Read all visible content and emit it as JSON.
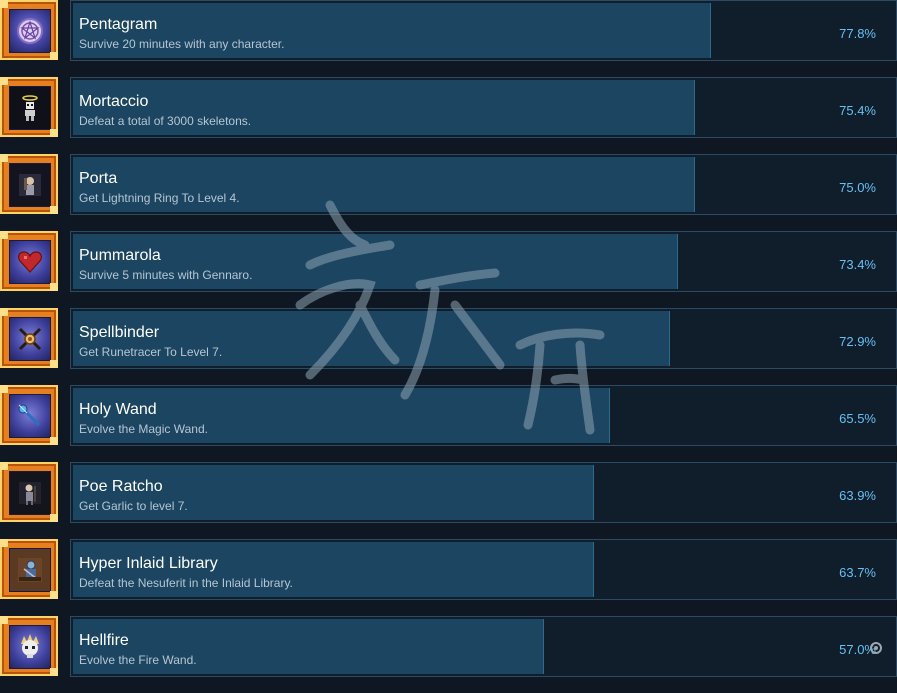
{
  "achievements": [
    {
      "title": "Pentagram",
      "desc": "Survive 20 minutes with any character.",
      "percent": "77.8%",
      "value": 77.8,
      "icon": "pentagram-icon"
    },
    {
      "title": "Mortaccio",
      "desc": "Defeat a total of 3000 skeletons.",
      "percent": "75.4%",
      "value": 75.4,
      "icon": "skeleton-icon"
    },
    {
      "title": "Porta",
      "desc": "Get Lightning Ring To Level 4.",
      "percent": "75.0%",
      "value": 75.0,
      "icon": "portrait-icon"
    },
    {
      "title": "Pummarola",
      "desc": "Survive 5 minutes with Gennaro.",
      "percent": "73.4%",
      "value": 73.4,
      "icon": "heart-icon"
    },
    {
      "title": "Spellbinder",
      "desc": "Get Runetracer To Level 7.",
      "percent": "72.9%",
      "value": 72.9,
      "icon": "crossed-swords-icon"
    },
    {
      "title": "Holy Wand",
      "desc": "Evolve the Magic Wand.",
      "percent": "65.5%",
      "value": 65.5,
      "icon": "wand-icon"
    },
    {
      "title": "Poe Ratcho",
      "desc": "Get Garlic to level 7.",
      "percent": "63.9%",
      "value": 63.9,
      "icon": "figure-icon"
    },
    {
      "title": "Hyper Inlaid Library",
      "desc": "Defeat the Nesuferit in the Inlaid Library.",
      "percent": "63.7%",
      "value": 63.7,
      "icon": "library-icon"
    },
    {
      "title": "Hellfire",
      "desc": "Evolve the Fire Wand.",
      "percent": "57.0%",
      "value": 57.0,
      "icon": "skull-fire-icon"
    }
  ],
  "colors": {
    "background": "#0f1822",
    "bar_fill": "#1b4560",
    "percent_text": "#66c0f4",
    "frame_orange": "#e67f1e"
  }
}
